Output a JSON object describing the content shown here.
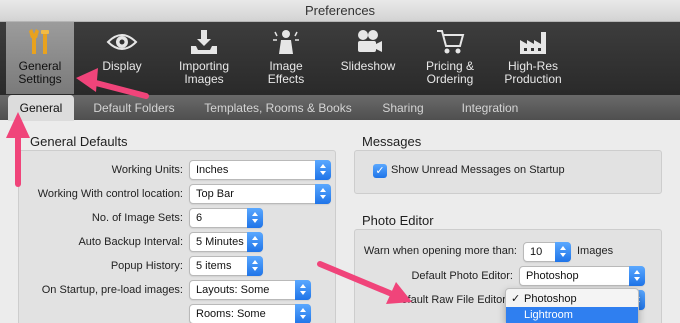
{
  "window": {
    "title": "Preferences"
  },
  "toolbar": {
    "items": [
      {
        "label": "General\nSettings",
        "icon": "tools-icon",
        "selected": true
      },
      {
        "label": "Display",
        "icon": "eye-icon"
      },
      {
        "label": "Importing\nImages",
        "icon": "import-tray-icon"
      },
      {
        "label": "Image\nEffects",
        "icon": "effects-figure-icon"
      },
      {
        "label": "Slideshow",
        "icon": "projector-icon"
      },
      {
        "label": "Pricing &\nOrdering",
        "icon": "shopping-cart-icon"
      },
      {
        "label": "High-Res\nProduction",
        "icon": "factory-icon"
      }
    ]
  },
  "subtabs": {
    "items": [
      "General",
      "Default Folders",
      "Templates, Rooms & Books",
      "Sharing",
      "Integration"
    ],
    "selected": "General"
  },
  "general_defaults": {
    "heading": "General Defaults",
    "rows": [
      {
        "label": "Working Units:",
        "value": "Inches"
      },
      {
        "label": "Working With control location:",
        "value": "Top Bar"
      },
      {
        "label": "No. of Image Sets:",
        "value": "6"
      },
      {
        "label": "Auto Backup Interval:",
        "value": "5 Minutes"
      },
      {
        "label": "Popup History:",
        "value": "5 items"
      },
      {
        "label": "On Startup, pre-load images:",
        "value": "Layouts: Some"
      },
      {
        "label": "",
        "value": "Rooms: Some"
      }
    ]
  },
  "messages": {
    "heading": "Messages",
    "checkbox_label": "Show Unread Messages on Startup",
    "checked": true
  },
  "photo_editor": {
    "heading": "Photo Editor",
    "warn_label": "Warn when opening more than:",
    "warn_value": "10",
    "warn_units": "Images",
    "default_editor_label": "Default Photo Editor:",
    "default_editor_value": "Photoshop",
    "raw_editor_label": "Default Raw File Editor:",
    "raw_menu": {
      "options": [
        "Photoshop",
        "Lightroom"
      ],
      "checked": "Photoshop",
      "highlighted": "Lightroom",
      "check_mark": "✓"
    }
  },
  "colors": {
    "accent": "#2f7ff0",
    "annotation_arrow": "#f0447a"
  }
}
